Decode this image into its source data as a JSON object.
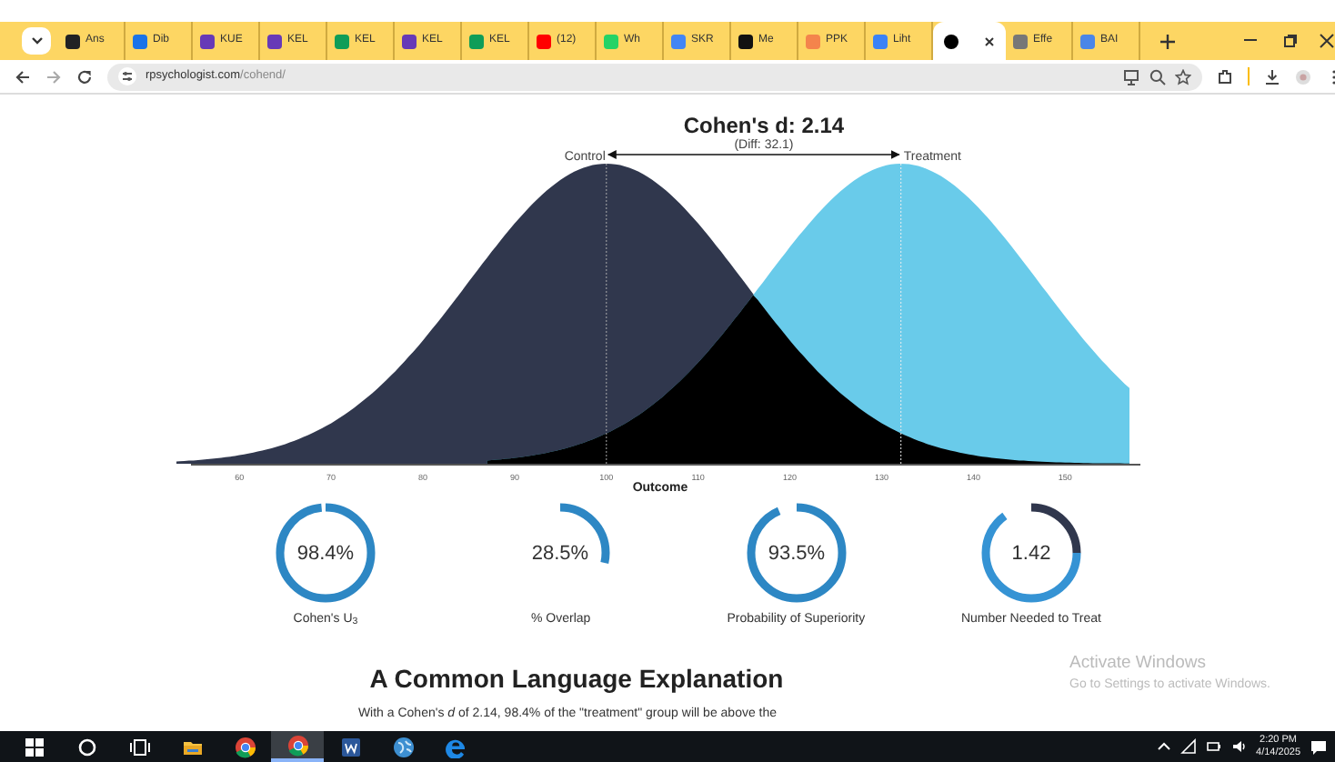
{
  "browser": {
    "tabs": [
      {
        "label": "Ans",
        "color": "#202124",
        "selected": false
      },
      {
        "label": "Dib",
        "color": "#1a73e8",
        "selected": false
      },
      {
        "label": "KUE",
        "color": "#673ab7",
        "selected": false
      },
      {
        "label": "KEL",
        "color": "#673ab7",
        "selected": false
      },
      {
        "label": "KEL",
        "color": "#0f9d58",
        "selected": false
      },
      {
        "label": "KEL",
        "color": "#673ab7",
        "selected": false
      },
      {
        "label": "KEL",
        "color": "#0f9d58",
        "selected": false
      },
      {
        "label": "(12)",
        "color": "#ff0000",
        "selected": false
      },
      {
        "label": "Wh",
        "color": "#25d366",
        "selected": false
      },
      {
        "label": "SKR",
        "color": "#4285f4",
        "selected": false
      },
      {
        "color": "#111111",
        "label": "Me",
        "selected": false
      },
      {
        "label": "PPK",
        "color": "#f4844c",
        "selected": false
      },
      {
        "label": "Liht",
        "color": "#3b82f6",
        "selected": false
      },
      {
        "color": "#000000",
        "selected": true
      },
      {
        "label": "Effe",
        "color": "#777777",
        "selected": false
      },
      {
        "label": "BAI",
        "color": "#4a86e8",
        "selected": false
      }
    ],
    "url_host": "rpsychologist.com",
    "url_path": "/cohend/"
  },
  "plot": {
    "title": "Cohen's d: 2.14",
    "subtitle": "(Diff: 32.1)",
    "control_label": "Control",
    "treatment_label": "Treatment",
    "x_ticks": [
      "60",
      "70",
      "80",
      "90",
      "100",
      "110",
      "120",
      "130",
      "140",
      "150"
    ],
    "xlabel": "Outcome"
  },
  "metrics": [
    {
      "kind": "percent",
      "value": "98.4%",
      "label": "Cohen's U$_{3}$",
      "level": 0.984
    },
    {
      "kind": "percent",
      "value": "28.5%",
      "label": "% Overlap",
      "level": 0.285
    },
    {
      "kind": "percent",
      "value": "93.5%",
      "label": "Probability of Superiority",
      "level": 0.935
    },
    {
      "kind": "nnt",
      "value": "1.42",
      "label": "Number Needed to Treat",
      "level": 0.65
    }
  ],
  "section": {
    "heading": "A Common Language Explanation",
    "text": "With a Cohen's *d* of 2.14, 98.4% of the \"treatment\" group will be above the"
  },
  "activation_notice": {
    "title": "Activate Windows",
    "text": "Go to Settings to activate Windows."
  },
  "taskbar": {
    "apps": [
      {
        "kind": "start",
        "selected": false
      },
      {
        "kind": "search",
        "selected": false
      },
      {
        "kind": "taskview",
        "selected": false
      },
      {
        "kind": "explorer",
        "selected": false
      },
      {
        "kind": "chrome",
        "selected": false
      },
      {
        "kind": "chrome",
        "selected": true
      },
      {
        "kind": "word",
        "selected": false
      },
      {
        "kind": "globe",
        "selected": false
      },
      {
        "kind": "edge",
        "selected": false
      }
    ],
    "clock": {
      "time": "2:20 PM",
      "date": "4/14/2025"
    }
  }
}
